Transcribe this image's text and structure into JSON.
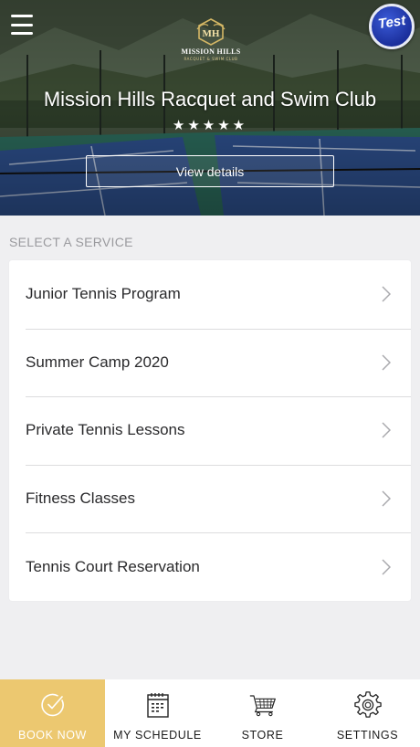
{
  "hero": {
    "club_name": "Mission Hills Racquet and Swim Club",
    "rating_stars": "★★★★★",
    "rating": 5,
    "view_details_label": "View details",
    "logo": {
      "monogram": "MH",
      "name": "MISSION HILLS",
      "subtitle": "RACQUET & SWIM CLUB"
    },
    "badge_label": "Test"
  },
  "services": {
    "section_label": "SELECT A SERVICE",
    "items": [
      {
        "label": "Junior Tennis Program"
      },
      {
        "label": "Summer Camp 2020"
      },
      {
        "label": "Private Tennis Lessons"
      },
      {
        "label": "Fitness Classes"
      },
      {
        "label": "Tennis Court Reservation"
      }
    ]
  },
  "bottom_nav": {
    "items": [
      {
        "label": "BOOK NOW",
        "icon": "check-circle-icon",
        "active": true
      },
      {
        "label": "MY SCHEDULE",
        "icon": "calendar-icon",
        "active": false
      },
      {
        "label": "STORE",
        "icon": "cart-icon",
        "active": false
      },
      {
        "label": "SETTINGS",
        "icon": "gear-icon",
        "active": false
      }
    ]
  },
  "colors": {
    "accent": "#ecc870",
    "background": "#efeff1",
    "badge_blue": "#1b2f9c"
  }
}
